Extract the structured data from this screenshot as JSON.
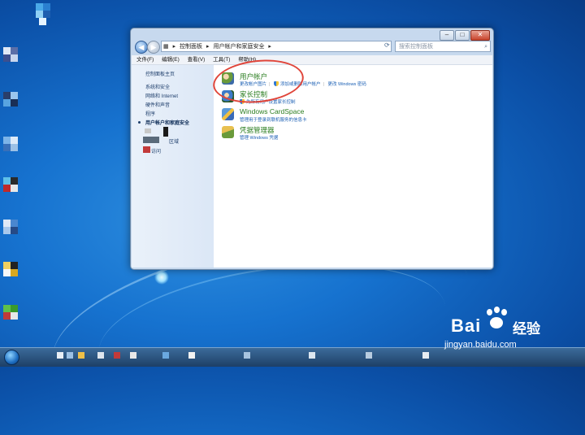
{
  "window": {
    "address": {
      "crumbs": [
        "控制面板",
        "用户帐户和家庭安全"
      ],
      "search_placeholder": "搜索控制面板"
    },
    "menu": [
      "文件(F)",
      "编辑(E)",
      "查看(V)",
      "工具(T)",
      "帮助(H)"
    ],
    "sidebar": {
      "home": "控制面板主页",
      "items": [
        "系统和安全",
        "网络和 Internet",
        "硬件和声音",
        "程序",
        "用户帐户和家庭安全",
        "区域",
        "访问"
      ]
    },
    "categories": [
      {
        "title": "用户帐户",
        "links": [
          "更改帐户图片",
          "添加或删除用户帐户",
          "更改 Windows 密码"
        ]
      },
      {
        "title": "家长控制",
        "links": [
          "为所有用户设置家长控制"
        ]
      },
      {
        "title": "Windows CardSpace",
        "links": [
          "管理用于登录到联机服务的信息卡"
        ]
      },
      {
        "title": "凭据管理器",
        "links": [
          "管理 Windows 凭据"
        ]
      }
    ]
  },
  "watermark": {
    "brand": "Bai",
    "brand_suffix": "经验",
    "url": "jingyan.baidu.com"
  },
  "colors": {
    "category_title": "#2a7d1f",
    "link": "#1a5fb4",
    "annotation": "#e0453a"
  }
}
